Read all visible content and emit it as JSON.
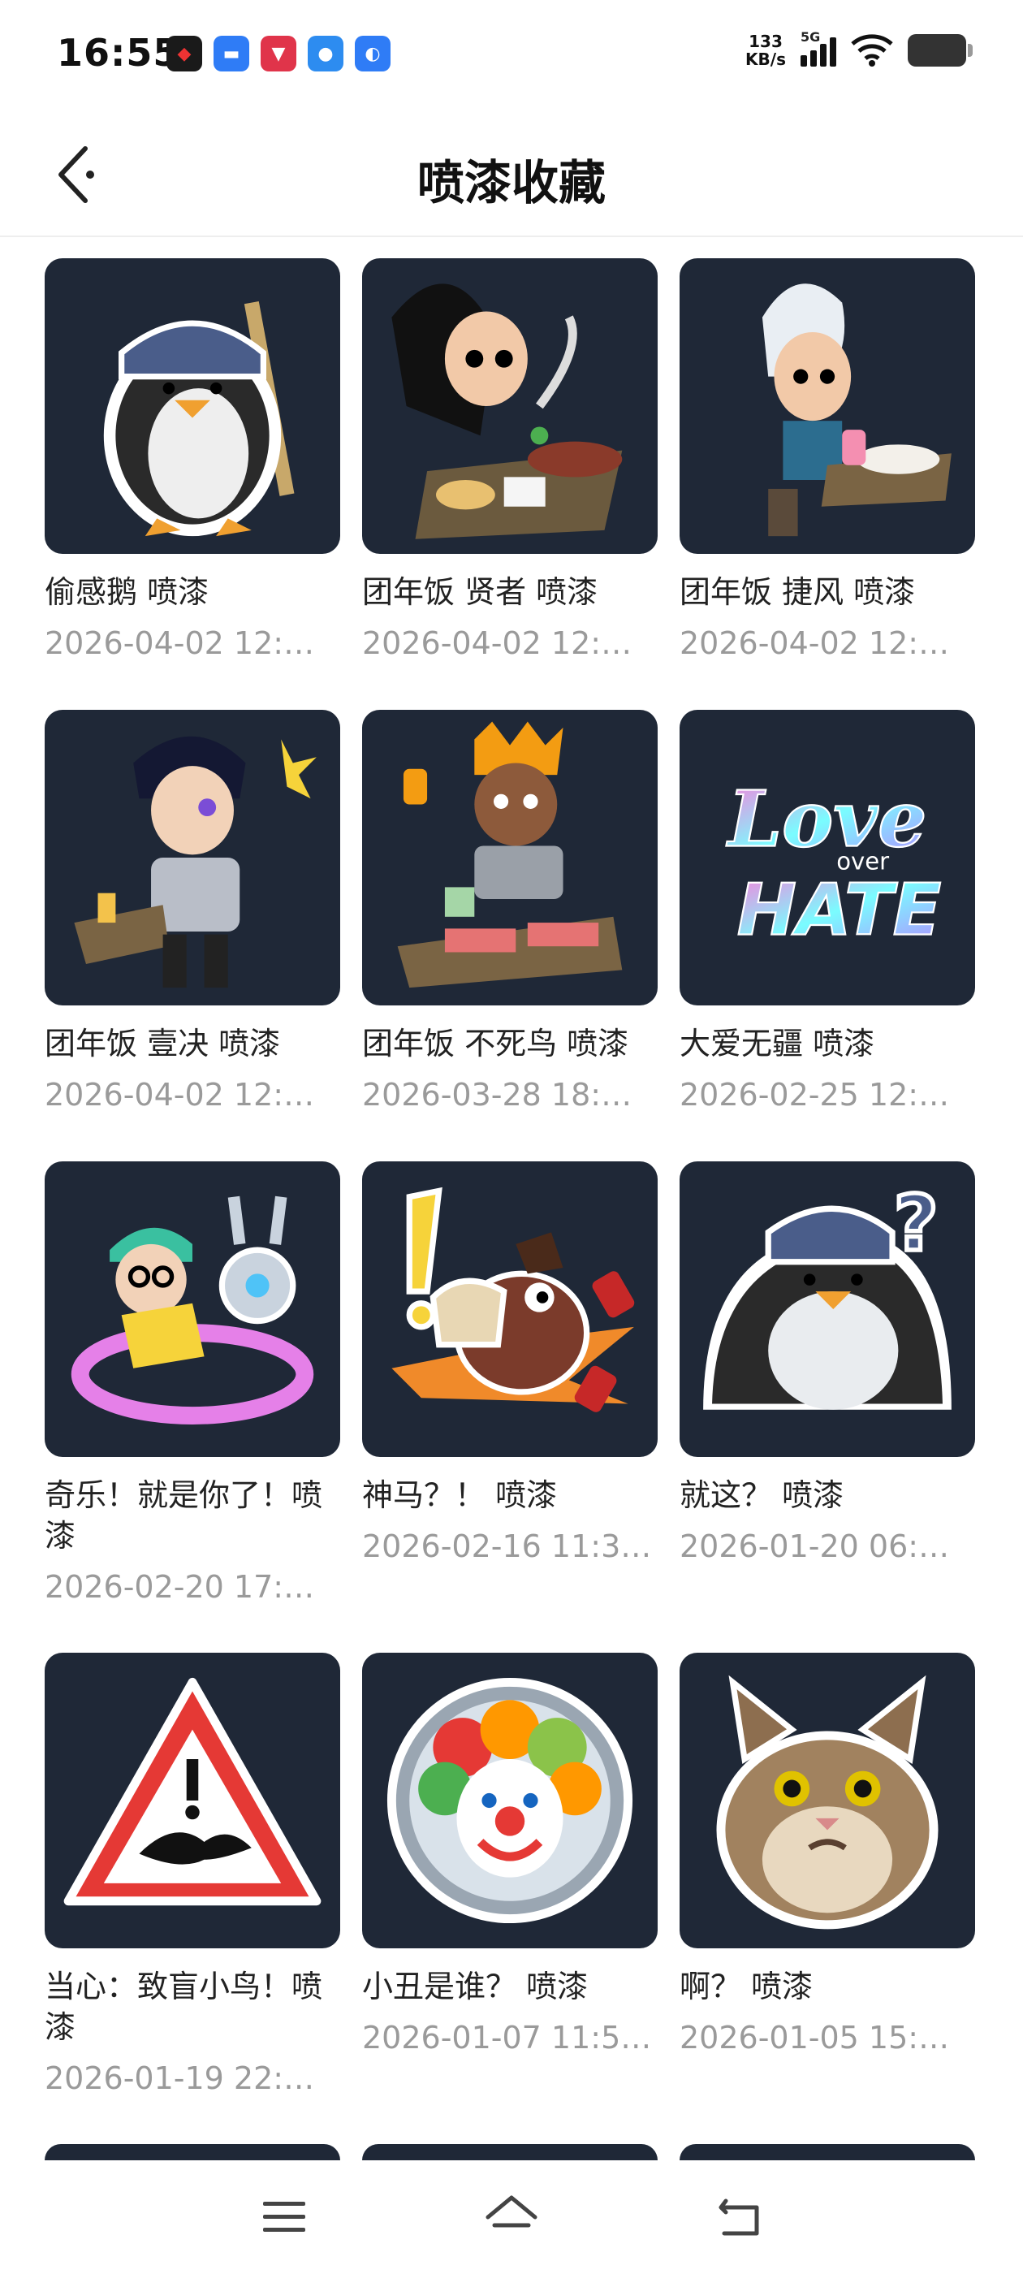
{
  "status_bar": {
    "time": "16:55",
    "net_speed_value": "133",
    "net_speed_unit": "KB/s",
    "network_type": "5G"
  },
  "header": {
    "title": "喷漆收藏"
  },
  "items": [
    {
      "name": "偷感鹅 喷漆",
      "date": "2026-04-02 12:…",
      "icon": "penguin-beanie-sticker"
    },
    {
      "name": "团年饭 贤者 喷漆",
      "date": "2026-04-02 12:…",
      "icon": "sage-dinner-sticker"
    },
    {
      "name": "团年饭 捷风 喷漆",
      "date": "2026-04-02 12:…",
      "icon": "jett-dinner-sticker"
    },
    {
      "name": "团年饭 壹决 喷漆",
      "date": "2026-04-02 12:…",
      "icon": "iso-dinner-sticker"
    },
    {
      "name": "团年饭 不死鸟 喷漆",
      "date": "2026-03-28 18:…",
      "icon": "phoenix-dinner-sticker"
    },
    {
      "name": "大爱无疆 喷漆",
      "date": "2026-02-25 12:…",
      "icon": "love-over-hate-sticker"
    },
    {
      "name": "奇乐！就是你了！喷漆",
      "date": "2026-02-20 17:…",
      "icon": "killjoy-sticker"
    },
    {
      "name": "神马？！ 喷漆",
      "date": "2026-02-16 11:3…",
      "icon": "horse-surprise-sticker"
    },
    {
      "name": "就这？ 喷漆",
      "date": "2026-01-20 06:…",
      "icon": "penguin-question-sticker"
    },
    {
      "name": "当心：致盲小鸟！喷漆",
      "date": "2026-01-19 22:…",
      "icon": "warning-bird-sticker"
    },
    {
      "name": "小丑是谁？ 喷漆",
      "date": "2026-01-07 11:5…",
      "icon": "clown-sticker"
    },
    {
      "name": "啊？ 喷漆",
      "date": "2026-01-05 15:…",
      "icon": "shocked-cat-sticker"
    }
  ],
  "colors": {
    "tile_bg": "#1f2837",
    "date_text": "#9a9a9a"
  }
}
